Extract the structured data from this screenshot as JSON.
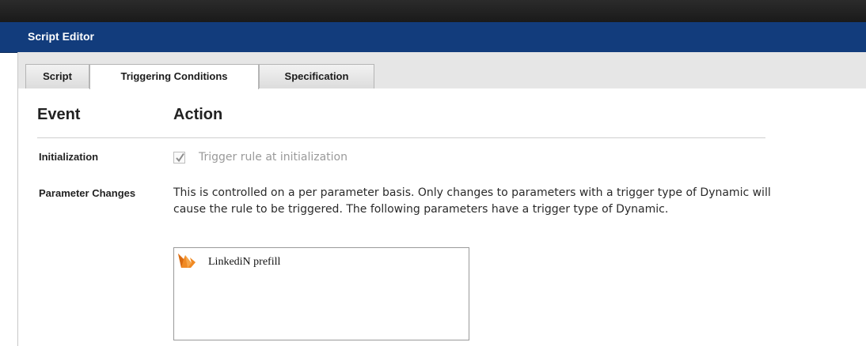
{
  "window": {
    "title": "Script Editor"
  },
  "tabs": [
    {
      "label": "Script",
      "active": false
    },
    {
      "label": "Triggering Conditions",
      "active": true
    },
    {
      "label": "Specification",
      "active": false
    }
  ],
  "headers": {
    "event": "Event",
    "action": "Action"
  },
  "rows": {
    "initialization": {
      "label": "Initialization",
      "checkbox_label": "Trigger rule at initialization",
      "checked": true
    },
    "parameter_changes": {
      "label": "Parameter Changes",
      "description": "This is controlled on a per parameter basis. Only changes to parameters with a trigger type of Dynamic will cause the rule to be triggered. The following parameters have a trigger type of Dynamic."
    }
  },
  "parameters": [
    {
      "label": "LinkediN prefill",
      "icon": "parameter-icon"
    }
  ],
  "colors": {
    "title_bar": "#123c7c",
    "tab_strip": "#e6e6e6",
    "icon_orange": "#f08a24"
  }
}
